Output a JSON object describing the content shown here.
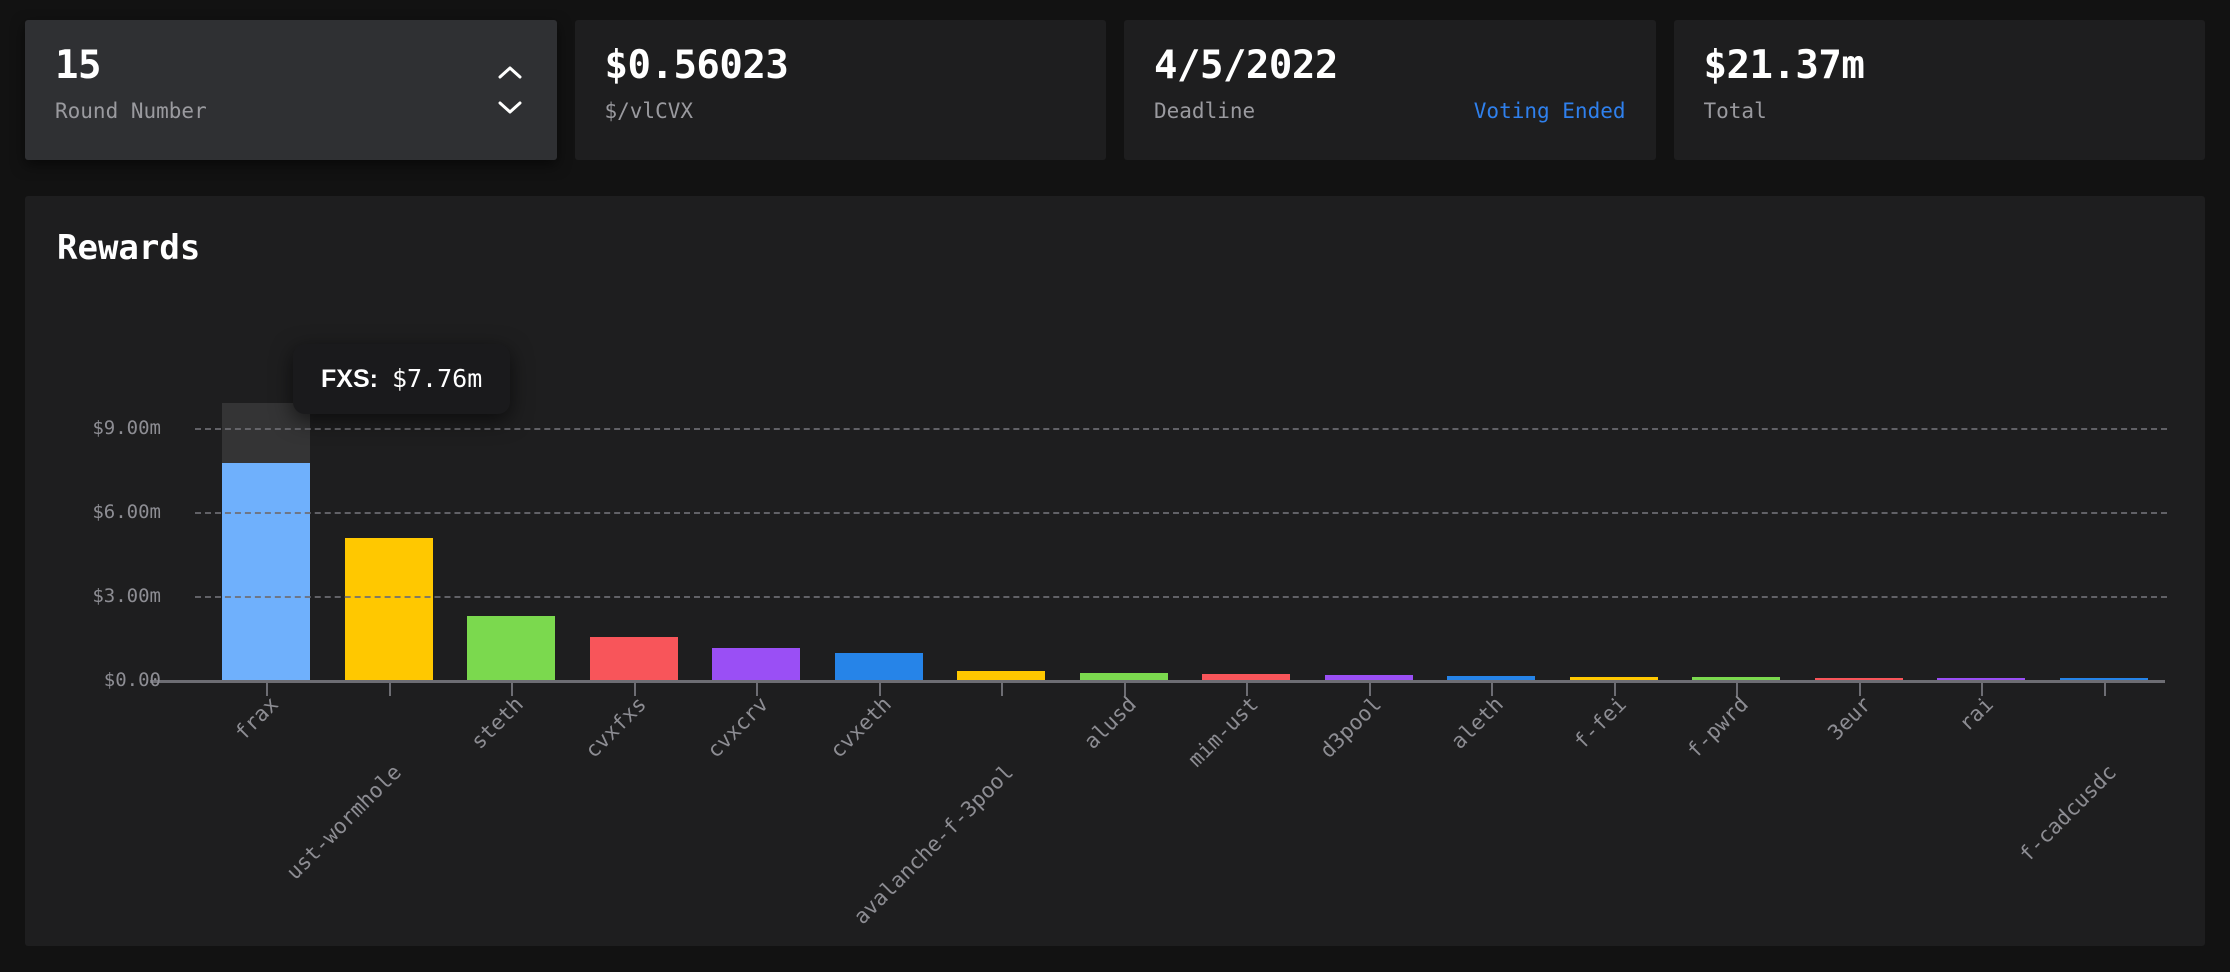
{
  "cards": [
    {
      "value": "15",
      "label": "Round Number",
      "status": "",
      "has_stepper": true,
      "raised": true
    },
    {
      "value": "$0.56023",
      "label": "$/vlCVX",
      "status": "",
      "has_stepper": false,
      "raised": false
    },
    {
      "value": "4/5/2022",
      "label": "Deadline",
      "status": "Voting Ended",
      "has_stepper": false,
      "raised": false
    },
    {
      "value": "$21.37m",
      "label": "Total",
      "status": "",
      "has_stepper": false,
      "raised": false
    }
  ],
  "panel": {
    "title": "Rewards"
  },
  "tooltip": {
    "name": "FXS:",
    "value": "$7.76m"
  },
  "colors": {
    "background": "#121212",
    "card": "#1e1e1f",
    "card_raised": "#2f3033",
    "accent_link": "#2f80ed",
    "grid": "#6d6d73",
    "axis_text": "#8d8d93"
  },
  "chart_data": {
    "type": "bar",
    "title": "Rewards",
    "xlabel": "",
    "ylabel": "",
    "ylim": [
      0,
      9.9
    ],
    "yticks": [
      "$0.00",
      "$3.00m",
      "$6.00m",
      "$9.00m"
    ],
    "ytick_values": [
      0,
      3,
      6,
      9
    ],
    "grid": true,
    "legend": "none",
    "value_unit": "millions USD",
    "categories": [
      "frax",
      "ust-wormhole",
      "steth",
      "cvxfxs",
      "cvxcrv",
      "cvxeth",
      "avalanche-f-3pool",
      "alusd",
      "mim-ust",
      "d3pool",
      "aleth",
      "f-fei",
      "f-pwrd",
      "3eur",
      "rai",
      "f-cadcusdc"
    ],
    "values": [
      7.76,
      5.08,
      2.28,
      1.53,
      1.14,
      0.96,
      0.33,
      0.26,
      0.21,
      0.19,
      0.15,
      0.11,
      0.09,
      0.07,
      0.05,
      0.04
    ],
    "bar_colors": [
      "#5fa8fc",
      "#ffc800",
      "#7bd94e",
      "#f8555a",
      "#9a4ff5",
      "#2684e8",
      "#ffc800",
      "#7bd94e",
      "#f8555a",
      "#9a4ff5",
      "#2684e8",
      "#ffc800",
      "#7bd94e",
      "#f8555a",
      "#9a4ff5",
      "#2684e8"
    ],
    "hovered_index": 0,
    "hovered_label": "FXS",
    "hovered_value_text": "$7.76m"
  }
}
